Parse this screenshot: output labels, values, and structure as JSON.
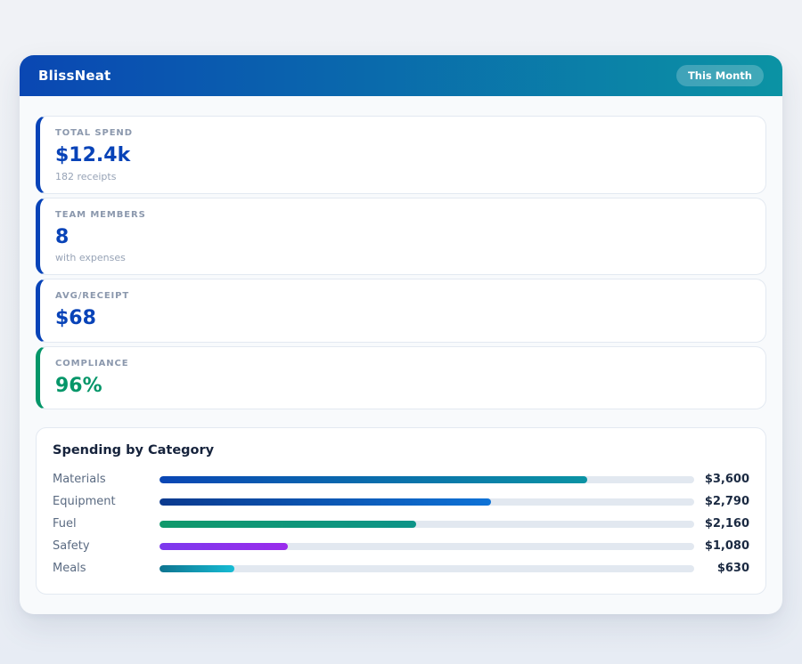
{
  "header": {
    "title": "BlissNeat",
    "badge": "This Month",
    "gradient_start": "#0a47b3",
    "gradient_end": "#0b93a4"
  },
  "stats": [
    {
      "label": "TOTAL SPEND",
      "value": "$12.4k",
      "sub": "182 receipts",
      "accent": "#0843b8",
      "value_color": "#0843b8"
    },
    {
      "label": "TEAM MEMBERS",
      "value": "8",
      "sub": "with expenses",
      "accent": "#0843b8",
      "value_color": "#0843b8"
    },
    {
      "label": "AVG/RECEIPT",
      "value": "$68",
      "sub": "",
      "accent": "#0843b8",
      "value_color": "#0843b8"
    },
    {
      "label": "COMPLIANCE",
      "value": "96%",
      "sub": "",
      "accent": "#059669",
      "value_color": "#059669"
    }
  ],
  "chart_data": {
    "type": "bar",
    "orientation": "horizontal",
    "title": "Spending by Category",
    "categories": [
      "Materials",
      "Equipment",
      "Fuel",
      "Safety",
      "Meals"
    ],
    "values": [
      3600,
      2790,
      2160,
      1080,
      630
    ],
    "value_labels": [
      "$3,600",
      "$2,790",
      "$2,160",
      "$1,080",
      "$630"
    ],
    "axis_max": 4500,
    "grid": false,
    "legend": false,
    "track_color": "#e2e8f0",
    "bar_gradients": [
      [
        "#0a46b4",
        "#0b93a4"
      ],
      [
        "#0b3a8f",
        "#0e72d6"
      ],
      [
        "#10996b",
        "#0d9488"
      ],
      [
        "#7c3aed",
        "#9a2cec"
      ],
      [
        "#0e7490",
        "#16bcd4"
      ]
    ]
  }
}
